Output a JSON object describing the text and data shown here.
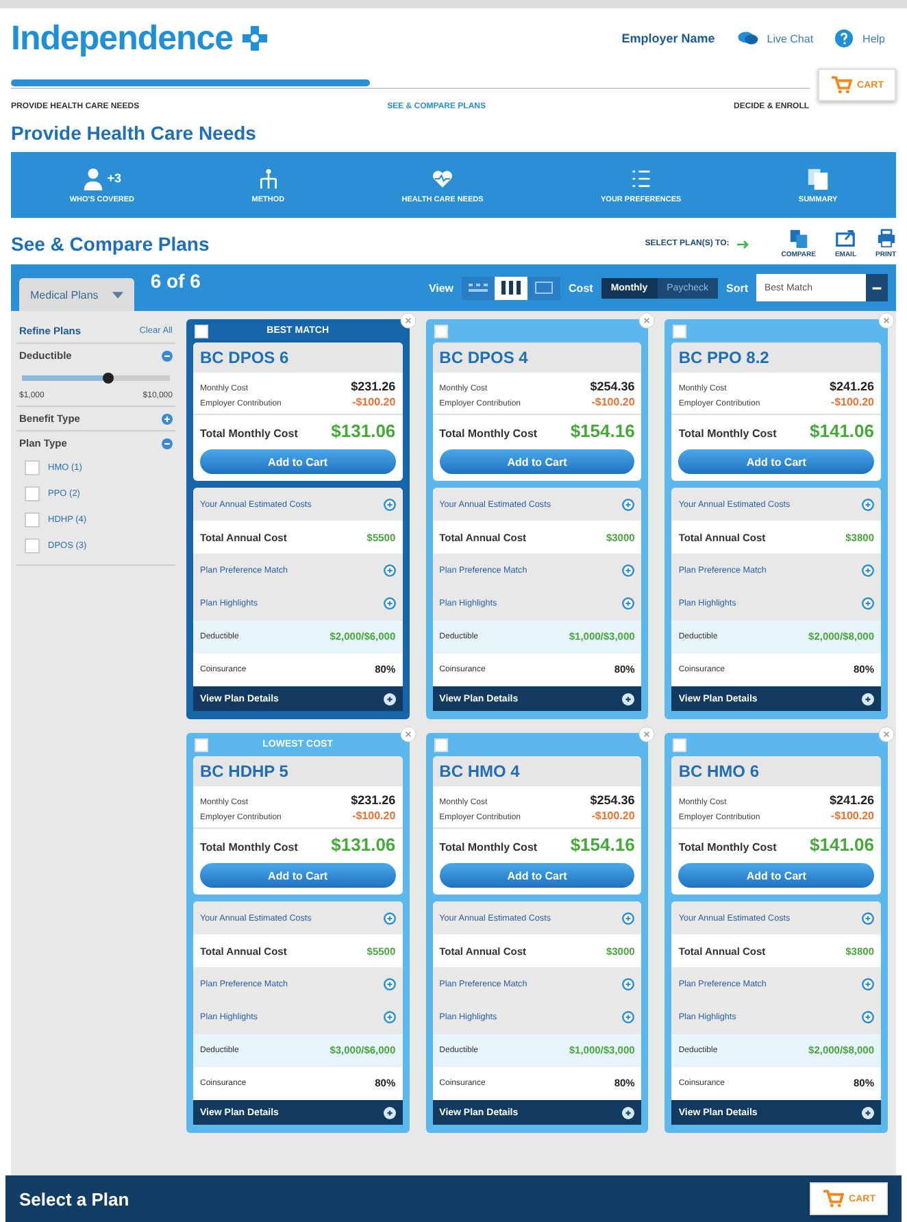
{
  "header": {
    "logo": "Independence",
    "employer": "Employer Name",
    "chat": "Live Chat",
    "help": "Help"
  },
  "progress": {
    "level": 0.45,
    "steps": [
      "PROVIDE HEALTH CARE NEEDS",
      "SEE & COMPARE PLANS",
      "DECIDE & ENROLL"
    ],
    "cart": "CART"
  },
  "needs": {
    "title": "Provide Health Care Needs",
    "items": [
      {
        "kind": "person",
        "label": "WHO'S COVERED",
        "badge": "+3"
      },
      {
        "kind": "method",
        "label": "METHOD"
      },
      {
        "kind": "heart",
        "label": "HEALTH CARE NEEDS"
      },
      {
        "kind": "list",
        "label": "YOUR PREFERENCES"
      },
      {
        "kind": "docs",
        "label": "SUMMARY"
      }
    ]
  },
  "compare": {
    "title": "See & Compare Plans",
    "select_label": "SELECT PLAN(S) TO:",
    "actions": [
      {
        "kind": "compare",
        "label": "COMPARE"
      },
      {
        "kind": "email",
        "label": "EMAIL"
      },
      {
        "kind": "print",
        "label": "PRINT"
      }
    ]
  },
  "toolbar": {
    "tab": "Medical Plans",
    "count": "6 of 6",
    "view_label": "View",
    "views": [
      {
        "kind": "list",
        "selected": false
      },
      {
        "kind": "columns",
        "selected": true
      },
      {
        "kind": "grid",
        "selected": false
      }
    ],
    "cost_label": "Cost",
    "costs": [
      {
        "label": "Monthly",
        "selected": true
      },
      {
        "label": "Paycheck",
        "selected": false
      }
    ],
    "sort_label": "Sort",
    "sort": "Best Match"
  },
  "filters": {
    "title": "Refine Plans",
    "clear": "Clear All",
    "deductible": {
      "label": "Deductible",
      "level": 0.58,
      "min": "$1,000",
      "max": "$10,000"
    },
    "benefit": "Benefit Type",
    "plan_type": "Plan Type",
    "options": [
      {
        "label": "HMO (1)",
        "checked": false
      },
      {
        "label": "PPO (2)",
        "checked": false
      },
      {
        "label": "HDHP (4)",
        "checked": false
      },
      {
        "label": "DPOS (3)",
        "checked": false
      }
    ]
  },
  "plans": [
    {
      "banner": "BEST MATCH",
      "selected": true,
      "checked": false,
      "name": "BC DPOS 6",
      "monthly_label": "Monthly Cost",
      "monthly": "$231.26",
      "contribution_label": "Employer Contribution",
      "contribution": "-$100.20",
      "total_label": "Total Monthly Cost",
      "total": "$131.06",
      "button": "Add to Cart",
      "annual_header": "Your Annual Estimated Costs",
      "annual_label": "Total Annual Cost",
      "annual": "$5500",
      "preference": "Plan Preference Match",
      "highlights": "Plan Highlights",
      "deductible_label": "Deductible",
      "deductible": "$2,000/$6,000",
      "coinsurance_label": "Coinsurance",
      "coinsurance": "80%",
      "details": "View Plan Details"
    },
    {
      "selected": false,
      "checked": false,
      "name": "BC DPOS 4",
      "monthly_label": "Monthly Cost",
      "monthly": "$254.36",
      "contribution_label": "Employer Contribution",
      "contribution": "-$100.20",
      "total_label": "Total Monthly Cost",
      "total": "$154.16",
      "button": "Add to Cart",
      "annual_header": "Your Annual Estimated Costs",
      "annual_label": "Total Annual Cost",
      "annual": "$3000",
      "preference": "Plan Preference Match",
      "highlights": "Plan Highlights",
      "deductible_label": "Deductible",
      "deductible": "$1,000/$3,000",
      "coinsurance_label": "Coinsurance",
      "coinsurance": "80%",
      "details": "View Plan Details"
    },
    {
      "selected": false,
      "checked": false,
      "name": "BC PPO 8.2",
      "monthly_label": "Monthly Cost",
      "monthly": "$241.26",
      "contribution_label": "Employer Contribution",
      "contribution": "-$100.20",
      "total_label": "Total Monthly Cost",
      "total": "$141.06",
      "button": "Add to Cart",
      "annual_header": "Your Annual Estimated Costs",
      "annual_label": "Total Annual Cost",
      "annual": "$3800",
      "preference": "Plan Preference Match",
      "highlights": "Plan Highlights",
      "deductible_label": "Deductible",
      "deductible": "$2,000/$8,000",
      "coinsurance_label": "Coinsurance",
      "coinsurance": "80%",
      "details": "View Plan Details"
    },
    {
      "banner": "LOWEST COST",
      "selected": false,
      "checked": false,
      "name": "BC HDHP 5",
      "monthly_label": "Monthly Cost",
      "monthly": "$231.26",
      "contribution_label": "Employer Contribution",
      "contribution": "-$100.20",
      "total_label": "Total Monthly Cost",
      "total": "$131.06",
      "button": "Add to Cart",
      "annual_header": "Your Annual Estimated Costs",
      "annual_label": "Total Annual Cost",
      "annual": "$5500",
      "preference": "Plan Preference Match",
      "highlights": "Plan Highlights",
      "deductible_label": "Deductible",
      "deductible": "$3,000/$6,000",
      "coinsurance_label": "Coinsurance",
      "coinsurance": "80%",
      "details": "View Plan Details"
    },
    {
      "selected": false,
      "checked": false,
      "name": "BC HMO 4",
      "monthly_label": "Monthly Cost",
      "monthly": "$254.36",
      "contribution_label": "Employer Contribution",
      "contribution": "-$100.20",
      "total_label": "Total Monthly Cost",
      "total": "$154.16",
      "button": "Add to Cart",
      "annual_header": "Your Annual Estimated Costs",
      "annual_label": "Total Annual Cost",
      "annual": "$3000",
      "preference": "Plan Preference Match",
      "highlights": "Plan Highlights",
      "deductible_label": "Deductible",
      "deductible": "$1,000/$3,000",
      "coinsurance_label": "Coinsurance",
      "coinsurance": "80%",
      "details": "View Plan Details"
    },
    {
      "selected": false,
      "checked": false,
      "name": "BC HMO 6",
      "monthly_label": "Monthly Cost",
      "monthly": "$241.26",
      "contribution_label": "Employer Contribution",
      "contribution": "-$100.20",
      "total_label": "Total Monthly Cost",
      "total": "$141.06",
      "button": "Add to Cart",
      "annual_header": "Your Annual Estimated Costs",
      "annual_label": "Total Annual Cost",
      "annual": "$3800",
      "preference": "Plan Preference Match",
      "highlights": "Plan Highlights",
      "deductible_label": "Deductible",
      "deductible": "$2,000/$8,000",
      "coinsurance_label": "Coinsurance",
      "coinsurance": "80%",
      "details": "View Plan Details"
    }
  ],
  "footer": {
    "title": "Select a Plan",
    "cart": "CART"
  }
}
